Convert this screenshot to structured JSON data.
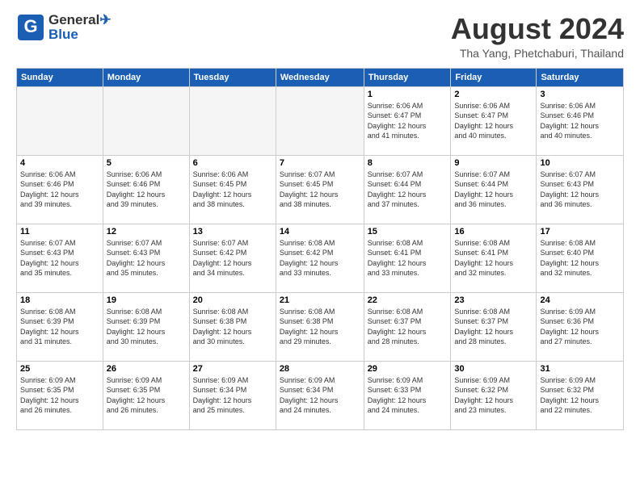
{
  "header": {
    "logo_general": "General",
    "logo_blue": "Blue",
    "month": "August 2024",
    "location": "Tha Yang, Phetchaburi, Thailand"
  },
  "days_of_week": [
    "Sunday",
    "Monday",
    "Tuesday",
    "Wednesday",
    "Thursday",
    "Friday",
    "Saturday"
  ],
  "weeks": [
    [
      {
        "num": "",
        "info": ""
      },
      {
        "num": "",
        "info": ""
      },
      {
        "num": "",
        "info": ""
      },
      {
        "num": "",
        "info": ""
      },
      {
        "num": "1",
        "info": "Sunrise: 6:06 AM\nSunset: 6:47 PM\nDaylight: 12 hours\nand 41 minutes."
      },
      {
        "num": "2",
        "info": "Sunrise: 6:06 AM\nSunset: 6:47 PM\nDaylight: 12 hours\nand 40 minutes."
      },
      {
        "num": "3",
        "info": "Sunrise: 6:06 AM\nSunset: 6:46 PM\nDaylight: 12 hours\nand 40 minutes."
      }
    ],
    [
      {
        "num": "4",
        "info": "Sunrise: 6:06 AM\nSunset: 6:46 PM\nDaylight: 12 hours\nand 39 minutes."
      },
      {
        "num": "5",
        "info": "Sunrise: 6:06 AM\nSunset: 6:46 PM\nDaylight: 12 hours\nand 39 minutes."
      },
      {
        "num": "6",
        "info": "Sunrise: 6:06 AM\nSunset: 6:45 PM\nDaylight: 12 hours\nand 38 minutes."
      },
      {
        "num": "7",
        "info": "Sunrise: 6:07 AM\nSunset: 6:45 PM\nDaylight: 12 hours\nand 38 minutes."
      },
      {
        "num": "8",
        "info": "Sunrise: 6:07 AM\nSunset: 6:44 PM\nDaylight: 12 hours\nand 37 minutes."
      },
      {
        "num": "9",
        "info": "Sunrise: 6:07 AM\nSunset: 6:44 PM\nDaylight: 12 hours\nand 36 minutes."
      },
      {
        "num": "10",
        "info": "Sunrise: 6:07 AM\nSunset: 6:43 PM\nDaylight: 12 hours\nand 36 minutes."
      }
    ],
    [
      {
        "num": "11",
        "info": "Sunrise: 6:07 AM\nSunset: 6:43 PM\nDaylight: 12 hours\nand 35 minutes."
      },
      {
        "num": "12",
        "info": "Sunrise: 6:07 AM\nSunset: 6:43 PM\nDaylight: 12 hours\nand 35 minutes."
      },
      {
        "num": "13",
        "info": "Sunrise: 6:07 AM\nSunset: 6:42 PM\nDaylight: 12 hours\nand 34 minutes."
      },
      {
        "num": "14",
        "info": "Sunrise: 6:08 AM\nSunset: 6:42 PM\nDaylight: 12 hours\nand 33 minutes."
      },
      {
        "num": "15",
        "info": "Sunrise: 6:08 AM\nSunset: 6:41 PM\nDaylight: 12 hours\nand 33 minutes."
      },
      {
        "num": "16",
        "info": "Sunrise: 6:08 AM\nSunset: 6:41 PM\nDaylight: 12 hours\nand 32 minutes."
      },
      {
        "num": "17",
        "info": "Sunrise: 6:08 AM\nSunset: 6:40 PM\nDaylight: 12 hours\nand 32 minutes."
      }
    ],
    [
      {
        "num": "18",
        "info": "Sunrise: 6:08 AM\nSunset: 6:39 PM\nDaylight: 12 hours\nand 31 minutes."
      },
      {
        "num": "19",
        "info": "Sunrise: 6:08 AM\nSunset: 6:39 PM\nDaylight: 12 hours\nand 30 minutes."
      },
      {
        "num": "20",
        "info": "Sunrise: 6:08 AM\nSunset: 6:38 PM\nDaylight: 12 hours\nand 30 minutes."
      },
      {
        "num": "21",
        "info": "Sunrise: 6:08 AM\nSunset: 6:38 PM\nDaylight: 12 hours\nand 29 minutes."
      },
      {
        "num": "22",
        "info": "Sunrise: 6:08 AM\nSunset: 6:37 PM\nDaylight: 12 hours\nand 28 minutes."
      },
      {
        "num": "23",
        "info": "Sunrise: 6:08 AM\nSunset: 6:37 PM\nDaylight: 12 hours\nand 28 minutes."
      },
      {
        "num": "24",
        "info": "Sunrise: 6:09 AM\nSunset: 6:36 PM\nDaylight: 12 hours\nand 27 minutes."
      }
    ],
    [
      {
        "num": "25",
        "info": "Sunrise: 6:09 AM\nSunset: 6:35 PM\nDaylight: 12 hours\nand 26 minutes."
      },
      {
        "num": "26",
        "info": "Sunrise: 6:09 AM\nSunset: 6:35 PM\nDaylight: 12 hours\nand 26 minutes."
      },
      {
        "num": "27",
        "info": "Sunrise: 6:09 AM\nSunset: 6:34 PM\nDaylight: 12 hours\nand 25 minutes."
      },
      {
        "num": "28",
        "info": "Sunrise: 6:09 AM\nSunset: 6:34 PM\nDaylight: 12 hours\nand 24 minutes."
      },
      {
        "num": "29",
        "info": "Sunrise: 6:09 AM\nSunset: 6:33 PM\nDaylight: 12 hours\nand 24 minutes."
      },
      {
        "num": "30",
        "info": "Sunrise: 6:09 AM\nSunset: 6:32 PM\nDaylight: 12 hours\nand 23 minutes."
      },
      {
        "num": "31",
        "info": "Sunrise: 6:09 AM\nSunset: 6:32 PM\nDaylight: 12 hours\nand 22 minutes."
      }
    ]
  ]
}
